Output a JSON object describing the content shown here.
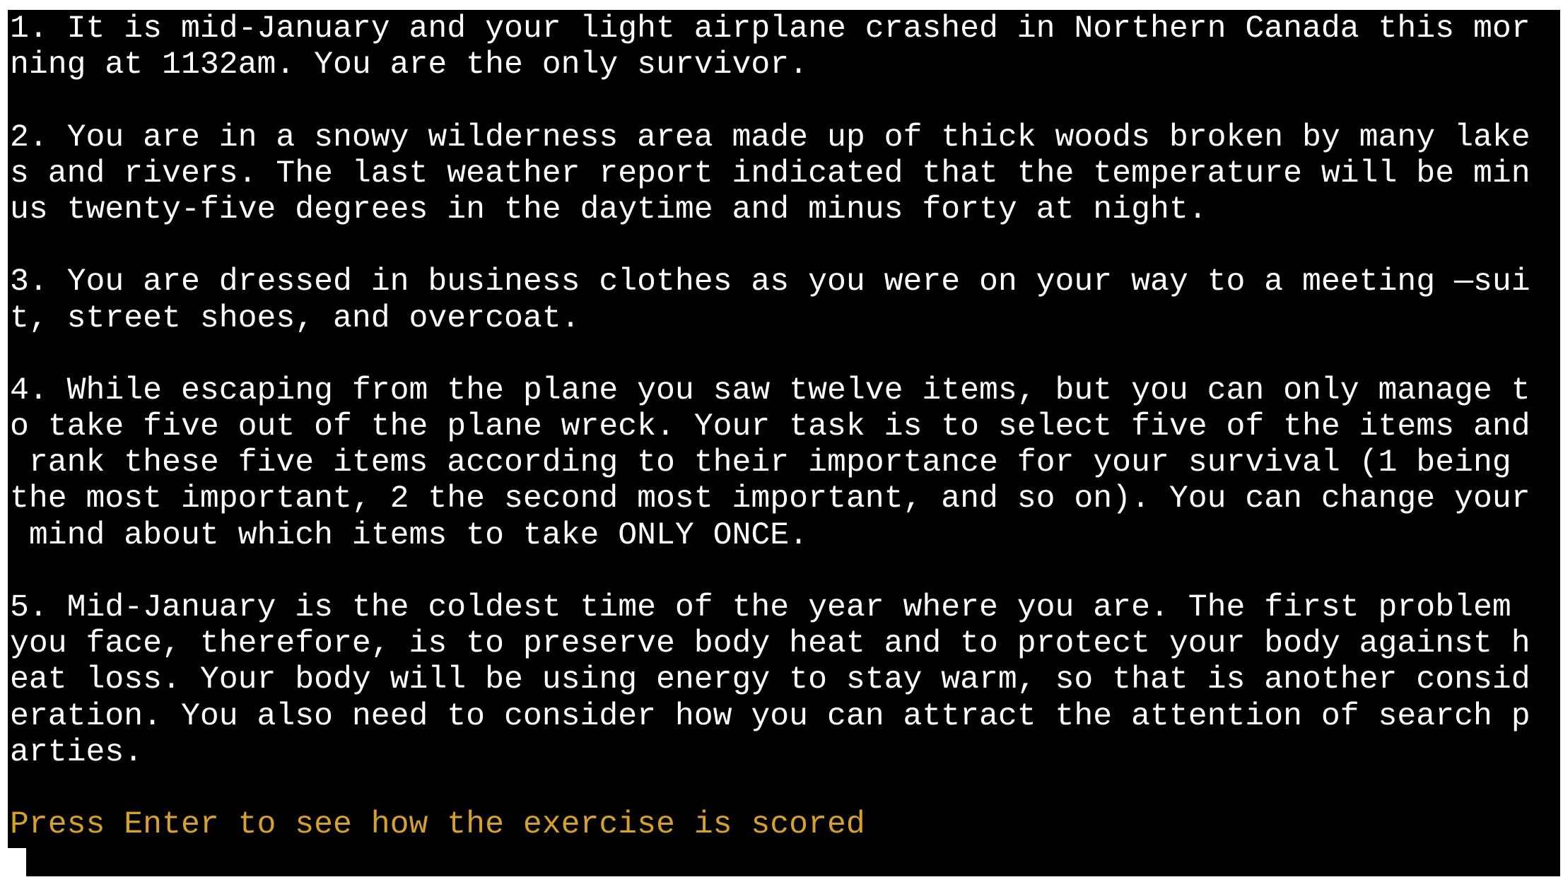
{
  "terminal": {
    "lines": [
      "1. It is mid-January and your light airplane crashed in Northern Canada this mor",
      "ning at 1132am. You are the only survivor.",
      "",
      "2. You are in a snowy wilderness area made up of thick woods broken by many lake",
      "s and rivers. The last weather report indicated that the temperature will be min",
      "us twenty-five degrees in the daytime and minus forty at night.",
      "",
      "3. You are dressed in business clothes as you were on your way to a meeting —sui",
      "t, street shoes, and overcoat.",
      "",
      "4. While escaping from the plane you saw twelve items, but you can only manage t",
      "o take five out of the plane wreck. Your task is to select five of the items and",
      " rank these five items according to their importance for your survival (1 being",
      "the most important, 2 the second most important, and so on). You can change your",
      " mind about which items to take ONLY ONCE.",
      "",
      "5. Mid-January is the coldest time of the year where you are. The first problem",
      "you face, therefore, is to preserve body heat and to protect your body against h",
      "eat loss. Your body will be using energy to stay warm, so that is another consid",
      "eration. You also need to consider how you can attract the attention of search p",
      "arties.",
      ""
    ],
    "prompt": "Press Enter to see how the exercise is scored"
  },
  "colors": {
    "background": "#000000",
    "text": "#ffffff",
    "prompt": "#d6a12b"
  }
}
